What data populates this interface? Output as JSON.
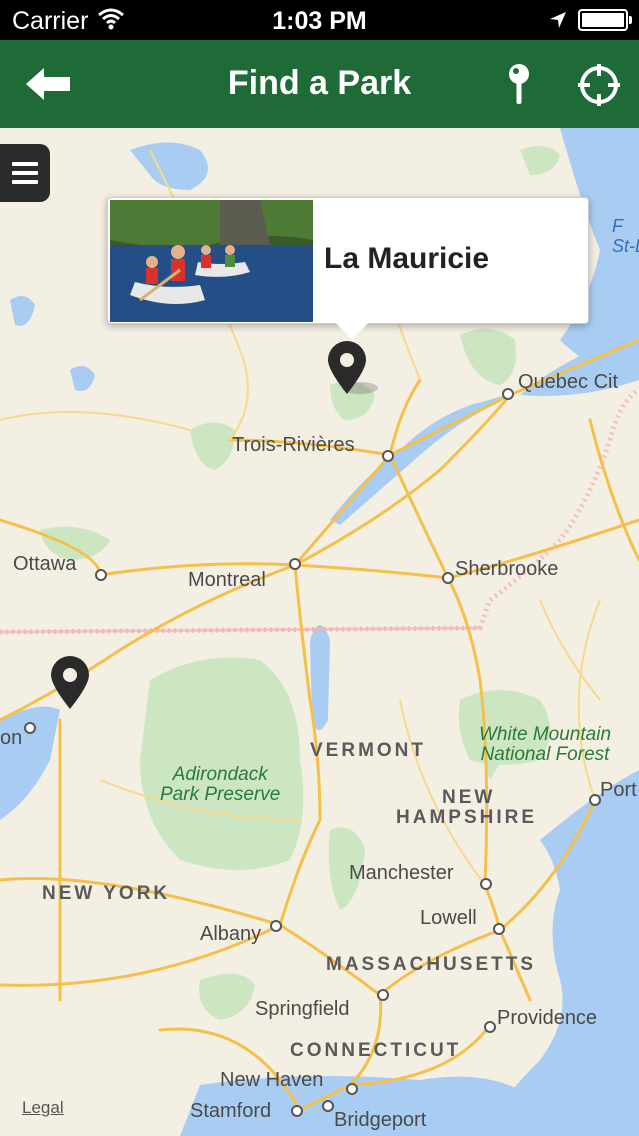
{
  "status_bar": {
    "carrier": "Carrier",
    "time": "1:03 PM"
  },
  "nav": {
    "title": "Find a Park"
  },
  "callout": {
    "park_name": "La Mauricie"
  },
  "map": {
    "legal": "Legal",
    "cities": [
      {
        "name": "Quebec Cit"
      },
      {
        "name": "Trois-Rivières"
      },
      {
        "name": "Ottawa"
      },
      {
        "name": "Montreal"
      },
      {
        "name": "Sherbrooke"
      },
      {
        "name": "Manchester"
      },
      {
        "name": "Lowell"
      },
      {
        "name": "Albany"
      },
      {
        "name": "Springfield"
      },
      {
        "name": "Providence"
      },
      {
        "name": "New Haven"
      },
      {
        "name": "Stamford"
      },
      {
        "name": "Bridgeport"
      },
      {
        "name": "Port"
      },
      {
        "name": "on"
      }
    ],
    "regions": [
      {
        "name": "VERMONT"
      },
      {
        "name": "NEW"
      },
      {
        "name": "HAMPSHIRE"
      },
      {
        "name": "NEW YORK"
      },
      {
        "name": "MASSACHUSETTS"
      },
      {
        "name": "CONNECTICUT"
      }
    ],
    "parks": [
      {
        "line1": "Adirondack",
        "line2": "Park Preserve"
      },
      {
        "line1": "White Mountain",
        "line2": "National Forest"
      }
    ],
    "water": {
      "line1": "F",
      "line2": "St-L"
    }
  }
}
